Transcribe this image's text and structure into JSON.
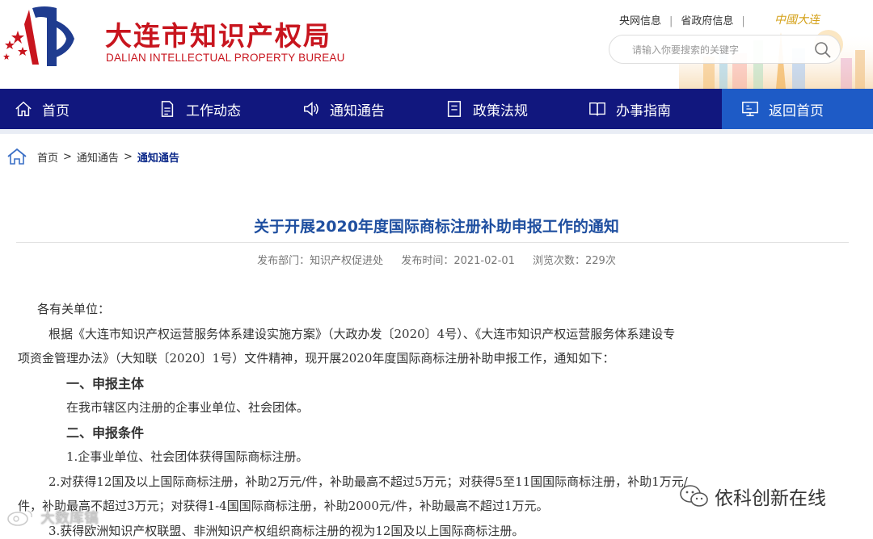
{
  "header": {
    "logo_cn": "大连市知识产权局",
    "logo_en": "DALIAN INTELLECTUAL PROPERTY BUREAU",
    "top_links": [
      "央网信息",
      "省政府信息"
    ],
    "brand": "中國大连",
    "search_placeholder": "请输入你要搜索的关键字"
  },
  "nav": {
    "items": [
      {
        "label": "首页",
        "icon": "home-icon"
      },
      {
        "label": "工作动态",
        "icon": "document-icon"
      },
      {
        "label": "通知通告",
        "icon": "speaker-icon"
      },
      {
        "label": "政策法规",
        "icon": "file-icon"
      },
      {
        "label": "办事指南",
        "icon": "book-icon"
      },
      {
        "label": "返回首页",
        "icon": "monitor-icon"
      }
    ],
    "active_color": "#1e5bc6",
    "bg_color": "#11177e"
  },
  "breadcrumb": [
    "首页",
    "通知通告",
    "通知通告"
  ],
  "article": {
    "title": "关于开展2020年度国际商标注册补助申报工作的通知",
    "meta": {
      "dept": "发布部门：知识产权促进处",
      "date": "发布时间：2021-02-01",
      "views": "浏览次数：229次"
    },
    "lines": [
      "各有关单位：",
      "根据《大连市知识产权运营服务体系建设实施方案》（大政办发〔2020〕4号）、《大连市知识产权运营服务体系建设专",
      "项资金管理办法》（大知联〔2020〕1号）文件精神，现开展2020年度国际商标注册补助申报工作，通知如下：",
      "一、申报主体",
      "在我市辖区内注册的企事业单位、社会团体。",
      "二、申报条件",
      "1.企事业单位、社会团体获得国际商标注册。",
      "2.对获得12国及以上国际商标注册，补助2万元/件，补助最高不超过5万元；对获得5至11国国际商标注册，补助1万元/",
      "件，补助最高不超过3万元；对获得1-4国国际商标注册，补助2000元/件，补助最高不超过1万元。",
      "3.获得欧洲知识产权联盟、非洲知识产权组织商标注册的视为12国及以上国际商标注册。"
    ]
  },
  "watermarks": {
    "wechat": "依科创新在线",
    "other": "大数库镐"
  }
}
